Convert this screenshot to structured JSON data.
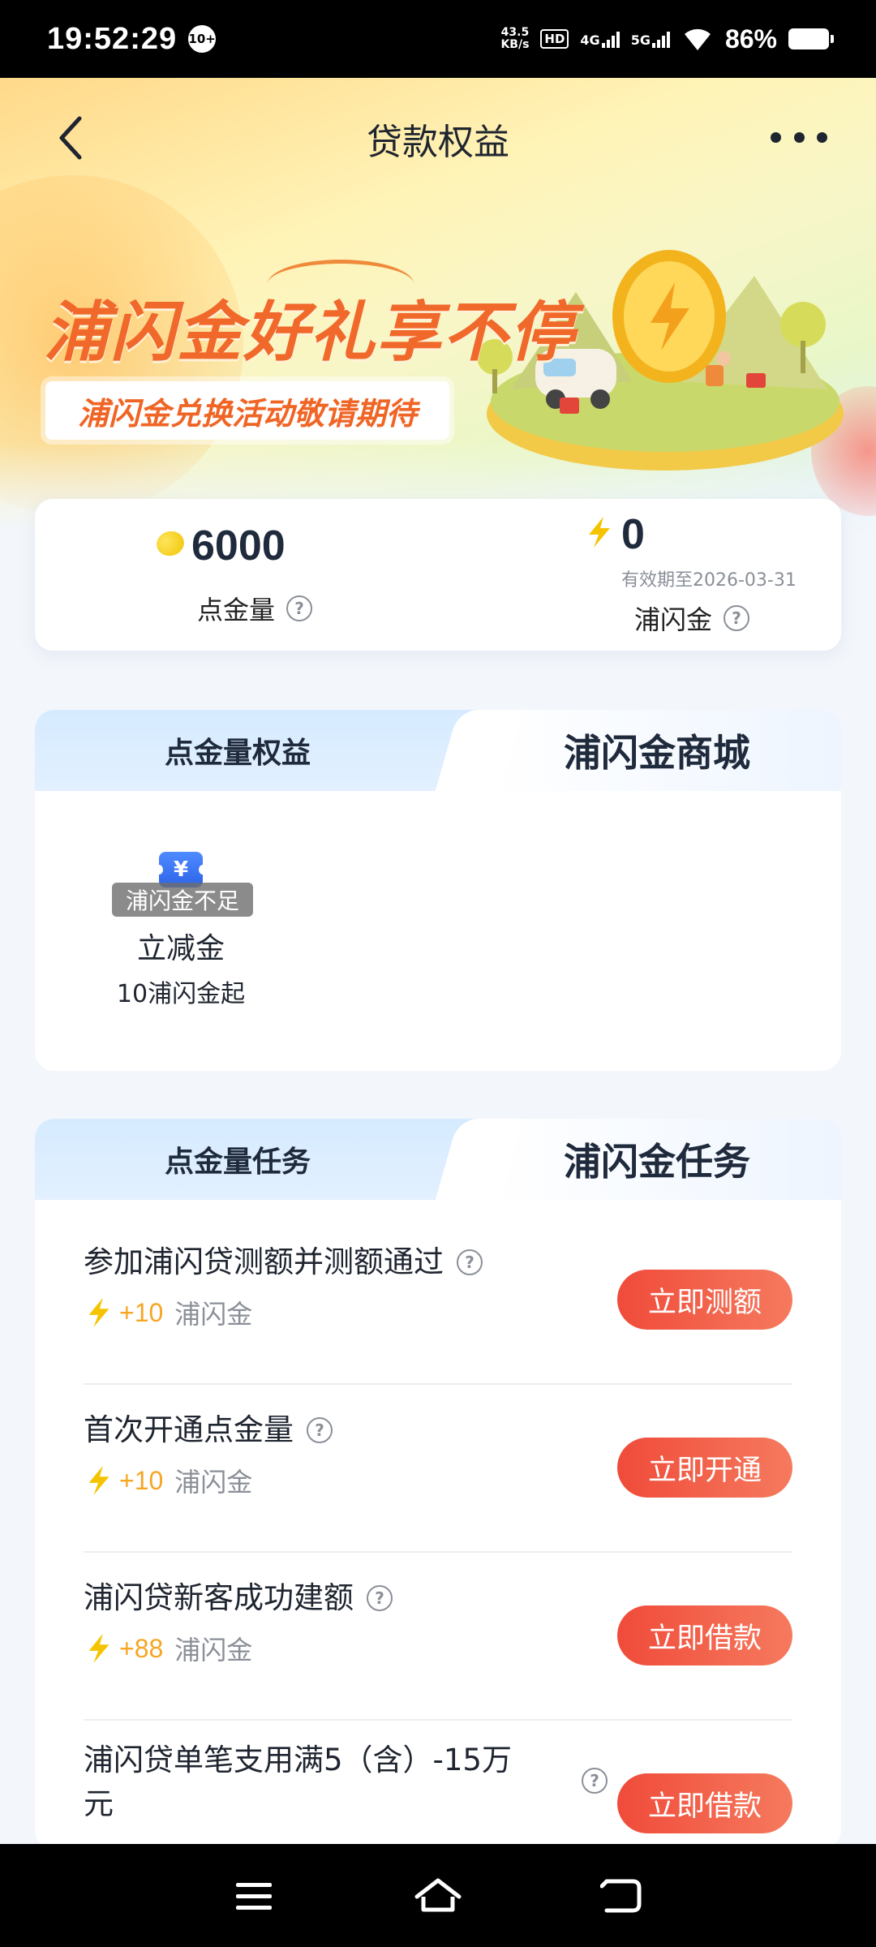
{
  "status_bar": {
    "time": "19:52:29",
    "notification_badge": "10+",
    "net_speed_value": "43.5",
    "net_speed_unit": "KB/s",
    "hd_label": "HD",
    "net1": "4G",
    "net2": "5G",
    "battery_pct": "86%"
  },
  "header": {
    "title": "贷款权益"
  },
  "banner": {
    "title": "浦闪金好礼享不停",
    "subtitle": "浦闪金兑换活动敬请期待"
  },
  "balances": {
    "points": {
      "value": "6000",
      "label": "点金量"
    },
    "flash_gold": {
      "value": "0",
      "expiry": "有效期至2026-03-31",
      "label": "浦闪金"
    }
  },
  "rights_tabs": {
    "left": "点金量权益",
    "right": "浦闪金商城",
    "active": "right"
  },
  "mall_items": [
    {
      "status": "浦闪金不足",
      "name": "立减金",
      "desc": "10浦闪金起"
    }
  ],
  "task_tabs": {
    "left": "点金量任务",
    "right": "浦闪金任务",
    "active": "right"
  },
  "tasks": [
    {
      "title": "参加浦闪贷测额并测额通过",
      "reward": "+10",
      "unit": "浦闪金",
      "button": "立即测额"
    },
    {
      "title": "首次开通点金量",
      "reward": "+10",
      "unit": "浦闪金",
      "button": "立即开通"
    },
    {
      "title": "浦闪贷新客成功建额",
      "reward": "+88",
      "unit": "浦闪金",
      "button": "立即借款"
    },
    {
      "title": "浦闪贷单笔支用满5（含）-15万",
      "title_line2": "元",
      "button": "立即借款"
    }
  ],
  "colors": {
    "accent_red": "#f04b3a",
    "reward_orange": "#f5a623",
    "tab_blue": "#d6ebff",
    "coin_yellow": "#f0c400"
  }
}
